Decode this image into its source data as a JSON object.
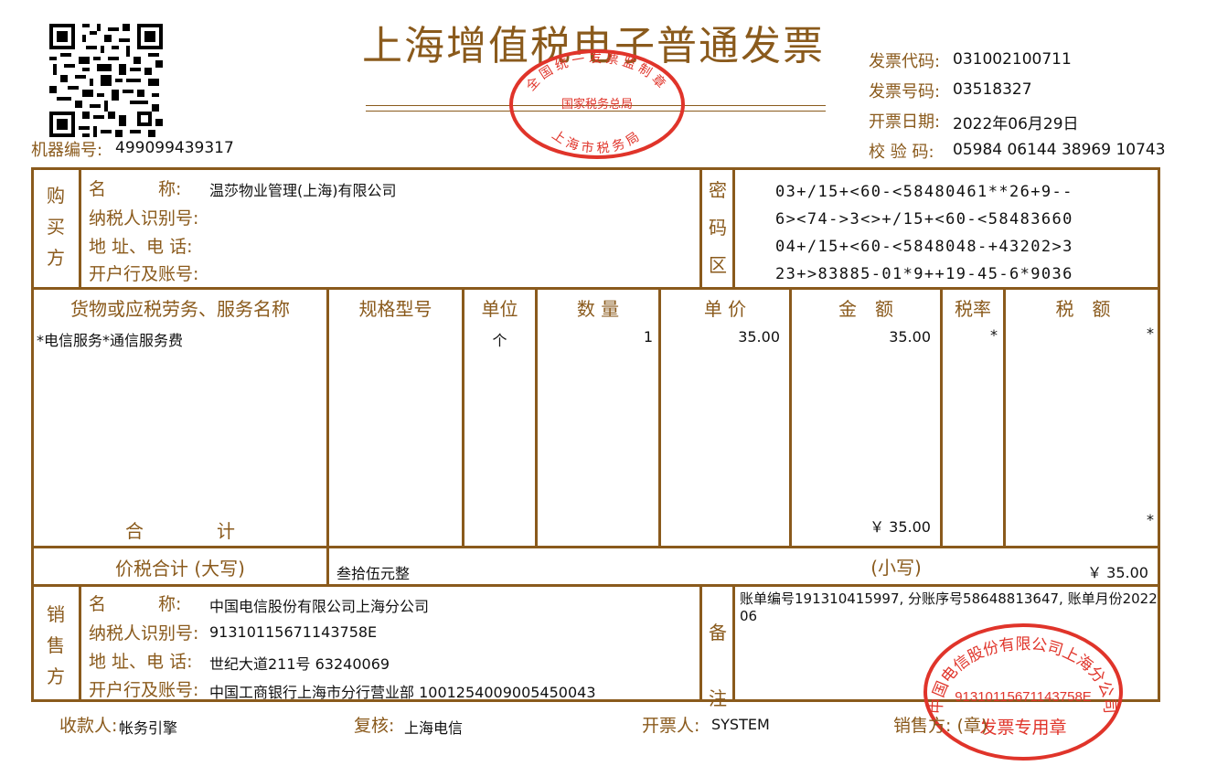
{
  "header": {
    "title": "上海增值税电子普通发票",
    "invoice_code_label": "发票代码:",
    "invoice_code": "031002100711",
    "invoice_no_label": "发票号码:",
    "invoice_no": "03518327",
    "date_label": "开票日期:",
    "date": "2022年06月29日",
    "check_label": "校 验 码:",
    "check_code": "05984 06144 38969 10743",
    "machine_label": "机器编号:",
    "machine_no": "499099439317"
  },
  "tax_stamp": {
    "line1": "全国统一发票监制章",
    "line2": "国家税务总局",
    "line3": "上海市税务局",
    "color": "#e0342a"
  },
  "buyer": {
    "section_label": [
      "购",
      "买",
      "方"
    ],
    "name_label": "名　　　称:",
    "name": "温莎物业管理(上海)有限公司",
    "tax_id_label": "纳税人识别号:",
    "tax_id": "",
    "address_label": "地 址、电 话:",
    "address": "",
    "bank_label": "开户行及账号:",
    "bank": ""
  },
  "cipher": {
    "section_label": [
      "密",
      "码",
      "区"
    ],
    "lines": [
      "03+/15+<60-<58480461**26+9--",
      "6><74->3<>+/15+<60-<58483660",
      "04+/15+<60-<5848048-+43202>3",
      "23+>83885-01*9++19-45-6*9036"
    ]
  },
  "items": {
    "headers": {
      "name": "货物或应税劳务、服务名称",
      "spec": "规格型号",
      "unit": "单位",
      "qty": "数 量",
      "price": "单 价",
      "amount": "金　额",
      "rate": "税率",
      "tax": "税　额"
    },
    "rows": [
      {
        "name": "*电信服务*通信服务费",
        "spec": "",
        "unit": "个",
        "qty": "1",
        "price": "35.00",
        "amount": "35.00",
        "rate": "*",
        "tax": "*"
      }
    ],
    "total_label": "合　　　　计",
    "total_amount": "￥ 35.00",
    "total_tax": "*"
  },
  "total": {
    "label": "价税合计 (大写)",
    "words": "叁拾伍元整",
    "small_label": "(小写)",
    "small_value": "￥ 35.00"
  },
  "seller": {
    "section_label": [
      "销",
      "售",
      "方"
    ],
    "name_label": "名　　　称:",
    "name": "中国电信股份有限公司上海分公司",
    "tax_id_label": "纳税人识别号:",
    "tax_id": "91310115671143758E",
    "address_label": "地 址、电 话:",
    "address": "世纪大道211号 63240069",
    "bank_label": "开户行及账号:",
    "bank": "中国工商银行上海市分行营业部 1001254009005450043"
  },
  "remarks": {
    "section_label": [
      "备",
      "注"
    ],
    "text_line1": "账单编号191310415997, 分账序号58648813647, 账单月份2022",
    "text_line2": "06"
  },
  "seller_stamp": {
    "company": "中国电信股份有限公司上海分公司",
    "tax_id": "91310115671143758E",
    "label": "发票专用章",
    "color": "#e0342a"
  },
  "footer": {
    "payee_label": "收款人:",
    "payee": "帐务引擎",
    "reviewer_label": "复核:",
    "reviewer": "上海电信",
    "issuer_label": "开票人:",
    "issuer": "SYSTEM",
    "seller_label": "销售方: (章)"
  }
}
